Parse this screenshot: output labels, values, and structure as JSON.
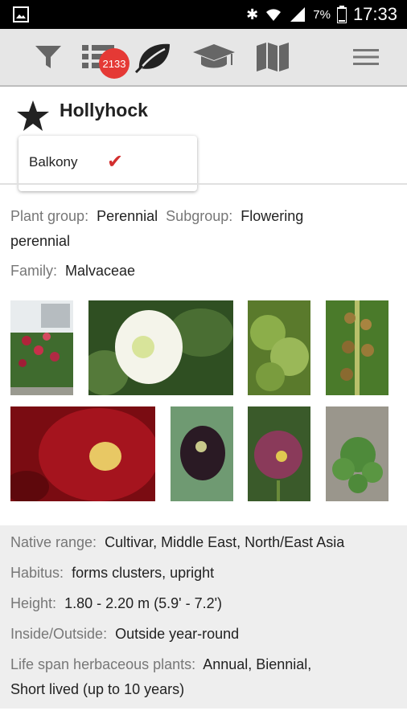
{
  "status": {
    "battery_pct": "7%",
    "time": "17:33"
  },
  "toolbar": {
    "badge_count": "2133"
  },
  "plant": {
    "name": "Hollyhock",
    "dropdown_item": "Balkony",
    "plant_group_label": "Plant group:",
    "plant_group_value": "Perennial",
    "subgroup_label": "Subgroup:",
    "subgroup_value": "Flowering",
    "subgroup_value_cont": "perennial",
    "family_label": "Family:",
    "family_value": "Malvaceae"
  },
  "details": {
    "native_label": "Native range:",
    "native_value": "Cultivar, Middle East, North/East Asia",
    "habitus_label": "Habitus:",
    "habitus_value": "forms clusters, upright",
    "height_label": "Height:",
    "height_value": "1.80 - 2.20 m (5.9' - 7.2')",
    "inout_label": "Inside/Outside:",
    "inout_value": "Outside year-round",
    "lifespan_label": "Life span herbaceous plants:",
    "lifespan_value": "Annual, Biennial,",
    "lifespan_value_cont": "Short lived (up to 10 years)"
  },
  "colors": {
    "accent": "#e53935",
    "check": "#d32f2f",
    "toolbar_bg": "#e6e6e6"
  }
}
